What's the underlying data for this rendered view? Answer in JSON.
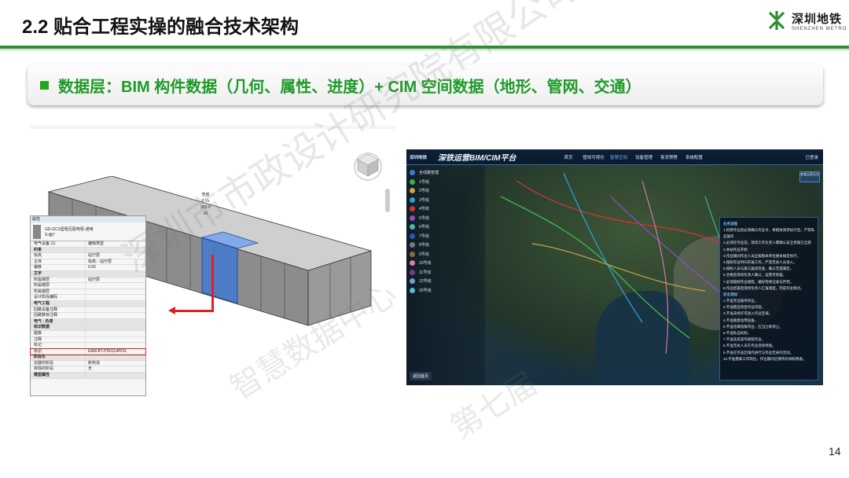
{
  "slide": {
    "title": "2.2 贴合工程实操的融合技术架构",
    "page_number": "14"
  },
  "logo": {
    "cn": "深圳地铁",
    "en": "SHENZHEN METRO",
    "brand_color": "#2f8f2f"
  },
  "banner": {
    "text": "数据层：BIM 构件数据（几何、属性、进度）+ CIM 空间数据（地形、管网、交通）",
    "accent": "#1f9a28"
  },
  "bim": {
    "dim_label": [
      "宽度",
      "0 Vs",
      "300 V",
      "43"
    ],
    "property_panel": {
      "header": "属性",
      "type_name": "GD-GCS型柜压配电柜-通用",
      "type_sub": "S-画7",
      "selector": "电气设备 (1)",
      "edit_type": "编辑类型",
      "rows": [
        {
          "k": "约束",
          "v": "",
          "sec": true
        },
        {
          "k": "标高",
          "v": "站厅层"
        },
        {
          "k": "主体",
          "v": "标高：站厅层"
        },
        {
          "k": "偏移",
          "v": "0.00"
        },
        {
          "k": "文字",
          "v": "",
          "sec": true
        },
        {
          "k": "所属楼层",
          "v": "站厅层"
        },
        {
          "k": "所属楼层",
          "v": ""
        },
        {
          "k": "所属楼层",
          "v": ""
        },
        {
          "k": "设计阶段编码",
          "v": ""
        },
        {
          "k": "电气工程",
          "v": "",
          "sec": true
        },
        {
          "k": "回路设备注释",
          "v": ""
        },
        {
          "k": "回路数目注释",
          "v": ""
        },
        {
          "k": "电气 - 负荷",
          "v": "",
          "sec": true
        },
        {
          "k": "标识数据",
          "v": "",
          "sec": true
        },
        {
          "k": "图像",
          "v": ""
        },
        {
          "k": "注释",
          "v": ""
        },
        {
          "k": "标记",
          "v": ""
        },
        {
          "k": "标识",
          "v": "EAM-BT-PD0114PDG",
          "hl": true
        },
        {
          "k": "阶段化",
          "v": "",
          "sec": true
        },
        {
          "k": "创建的阶段",
          "v": "新构造"
        },
        {
          "k": "拆除的阶段",
          "v": "无"
        },
        {
          "k": "模型属性",
          "v": "",
          "sec": true
        }
      ]
    }
  },
  "cim": {
    "brand": "深圳地铁",
    "app_title": "深铁运营BIM/CIM平台",
    "nav": [
      "首页",
      "管线可视化",
      "智慧空间",
      "设备管理",
      "客流预警",
      "系统配置"
    ],
    "active_nav": "智慧空间",
    "user": "已登录",
    "side_items": [
      {
        "label": "全线路管理",
        "color": "#3a7bd5"
      },
      {
        "label": "1号线",
        "color": "#3fae49"
      },
      {
        "label": "2号线",
        "color": "#c8a44a"
      },
      {
        "label": "3号线",
        "color": "#2c9fd8"
      },
      {
        "label": "4号线",
        "color": "#d8342c"
      },
      {
        "label": "5号线",
        "color": "#8d4fc4"
      },
      {
        "label": "6号线",
        "color": "#48b8a8"
      },
      {
        "label": "7号线",
        "color": "#2b58b8"
      },
      {
        "label": "8号线",
        "color": "#7a7a7a"
      },
      {
        "label": "9号线",
        "color": "#8a6a3a"
      },
      {
        "label": "10号线",
        "color": "#e07ab0"
      },
      {
        "label": "11号线",
        "color": "#7b3a8a"
      },
      {
        "label": "12号线",
        "color": "#6fa0d8"
      },
      {
        "label": "20号线",
        "color": "#54c0c8"
      }
    ],
    "back_label": "返回首页",
    "mini_btn": "查看运营总览",
    "right_list": {
      "section1": "业务流程",
      "items1": [
        "1.检修作业前必须确认作业令，将相关请求执行后，严禁私",
        "自操作",
        "2.必须在作业前，现场工作负责人需确认安全措施已全部",
        "3.本站作业开始",
        "3.作业期间作业人员应按照本单位相关规定执行。",
        "4.按照作业时间开展工作，严禁无关人员进入。",
        "5.按照人员与施工器具检查，确认无遗漏后。",
        "6.合格后现场负责人确认，运营可恢复。",
        "7.必须按照作业规程，做好检修记录与存档。",
        "8.作业结束后现场负责人汇报调度，完成作业销点。"
      ],
      "section2": "安全须知",
      "items2": [
        "1.不准无证操作作业。",
        "2.不准擅自改变作业内容。",
        "3.不准未经许可进入作业区域。",
        "4.不准随意动用设备。",
        "5.不准违章指挥作业，应当立即停止。",
        "6.不准私自拆卸。",
        "7.不准违反操作规程作业。",
        "8.不准无关人员在作业现场停留。",
        "9.不准在作业区域内进行与作业无关的活动。",
        "10.不准擅离工作岗位，作业期间应保持对讲机畅通。"
      ]
    }
  },
  "watermark": {
    "line1": "深圳市市政设计研究院有限公司",
    "line2": "智慧数据中心",
    "line3": "第七届"
  }
}
